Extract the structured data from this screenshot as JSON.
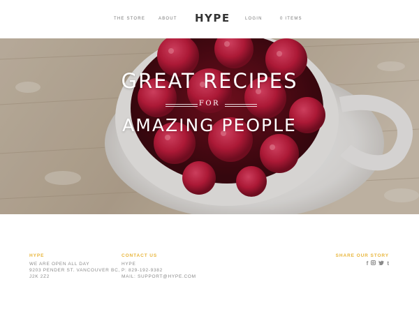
{
  "header": {
    "nav_left": [
      "THE STORE",
      "ABOUT"
    ],
    "logo": "HYPE",
    "nav_right": [
      "LOGIN",
      "0 ITEMS"
    ]
  },
  "hero": {
    "line1": "GREAT RECIPES",
    "connector": "FOR",
    "line2": "AMAZING PEOPLE"
  },
  "footer": {
    "col1": {
      "heading": "HYPE",
      "lines": [
        "WE ARE OPEN ALL DAY",
        "9203 PENDER ST. VANCOUVER BC,",
        "J2K 2Z2"
      ]
    },
    "col2": {
      "heading": "CONTACT US",
      "lines": [
        "HYPE",
        "P: 829-192-9382",
        "MAIL: SUPPORT@HYPE.COM"
      ]
    },
    "col3": {
      "heading": "SHARE OUR STORY",
      "icons": [
        "facebook-icon",
        "instagram-icon",
        "twitter-icon",
        "tumblr-icon"
      ]
    }
  },
  "colors": {
    "accent": "#e8b53a",
    "text_muted": "#8a8a8a",
    "logo": "#333333"
  }
}
